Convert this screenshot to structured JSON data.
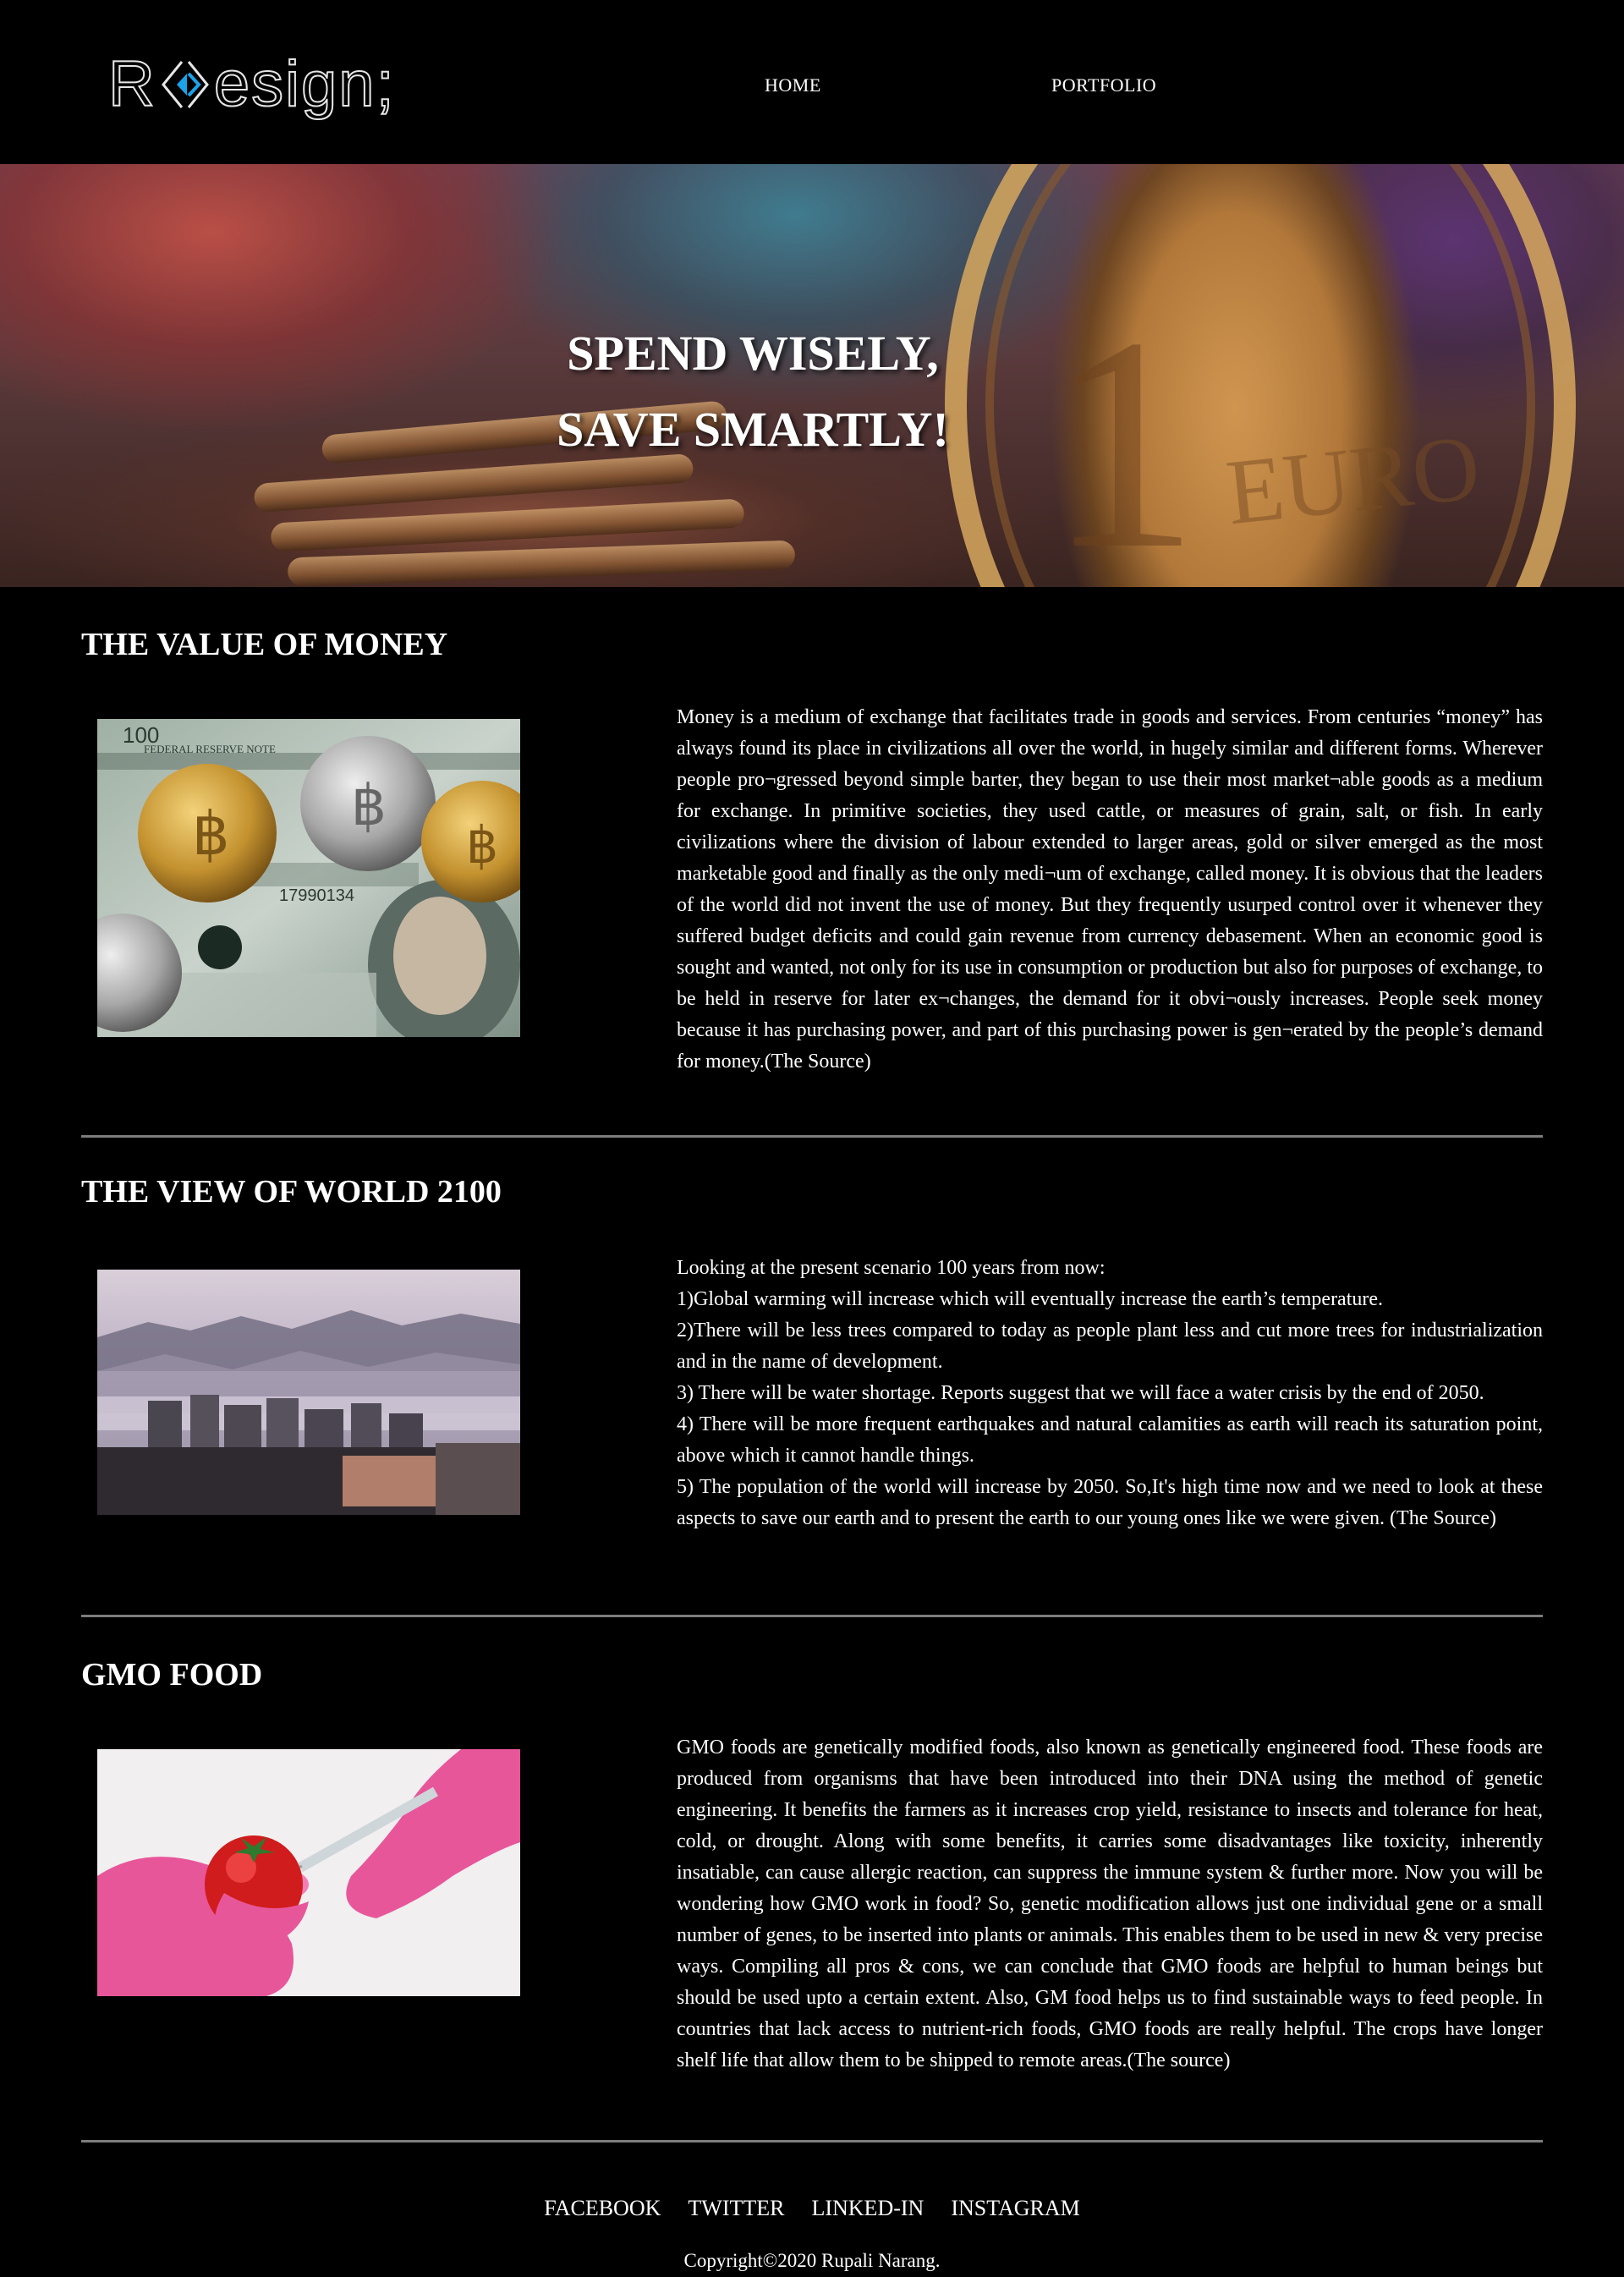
{
  "header": {
    "logo_text_start": "R",
    "logo_text_end": "esign;",
    "nav": [
      {
        "label": "HOME"
      },
      {
        "label": "PORTFOLIO"
      }
    ]
  },
  "hero": {
    "line1": "SPEND WISELY,",
    "line2": "SAVE SMARTLY!",
    "coin_numeral": "1",
    "coin_text": "EURO"
  },
  "sections": [
    {
      "title": "THE VALUE OF MONEY",
      "body": "Money is a medium of exchange that facilitates trade in goods and services. From centuries “money” has always found its place in civilizations all over the world, in hugely similar and different forms. Wherever people pro¬gressed beyond simple barter, they began to use their most market¬able goods as a medium for exchange. In primitive societies, they used cattle, or measures of grain, salt, or fish. In early civilizations where the division of labour extended to larger areas, gold or silver emerged as the most marketable good and finally as the only medi¬um of exchange, called money. It is obvious that the leaders of the world did not invent the use of money. But they frequently usurped control over it whenever they suffered budget deficits and could gain revenue from currency debasement. When an economic good is sought and wanted, not only for its use in consumption or production but also for purposes of exchange, to be held in reserve for later ex¬changes, the demand for it obvi¬ously increases. People seek money because it has purchasing power, and part of this purchasing power is gen¬erated by the people’s demand for money.(The Source)",
      "image_text": {
        "bill_label": "FEDERAL RESERVE NOTE",
        "serial": "17990134",
        "denomination": "100"
      }
    },
    {
      "title": "THE VIEW OF WORLD 2100",
      "lines": [
        "Looking at the present scenario 100 years from now:",
        "1)Global warming will increase which will eventually increase the earth’s temperature.",
        "2)There will be less trees compared to today as people plant less and cut more trees for industrialization and in the name of development.",
        "3) There will be water shortage. Reports suggest that we will face a water crisis by the end of 2050.",
        "4) There will be more frequent earthquakes and natural calamities as earth will reach its saturation point, above which it cannot handle things.",
        "5) The population of the world will increase by 2050. So,It's high time now and we need to look at these aspects to save our earth and to present the earth to our young ones like we were given. (The Source)"
      ]
    },
    {
      "title": "GMO FOOD",
      "body": "GMO foods are genetically modified foods, also known as genetically engineered food. These foods are produced from organisms that have been introduced into their DNA using the method of genetic engineering. It benefits the farmers as it increases crop yield, resistance to insects and tolerance for heat, cold, or drought. Along with some benefits, it carries some disadvantages like toxicity, inherently insatiable, can cause allergic reaction, can suppress the immune system & further more. Now you will be wondering how GMO work in food? So, genetic modification allows just one individual gene or a small number of genes, to be inserted into plants or animals. This enables them to be used in new & very precise ways. Compiling all pros & cons, we can conclude that GMO foods are helpful to human beings but should be used upto a certain extent. Also, GM food helps us to find sustainable ways to feed people. In countries that lack access to nutrient-rich foods, GMO foods are really helpful. The crops have longer shelf life that allow them to be shipped to remote areas.(The source)"
    }
  ],
  "footer": {
    "links": [
      {
        "label": "FACEBOOK"
      },
      {
        "label": "TWITTER"
      },
      {
        "label": "LINKED-IN"
      },
      {
        "label": "INSTAGRAM"
      }
    ],
    "copyright": "Copyright©2020 Rupali Narang."
  },
  "colors": {
    "background": "#000000",
    "text": "#ffffff",
    "divider": "#7c7c7c",
    "logo_accent": "#1aa3e8"
  },
  "icons": [
    "logo-chevron-icon"
  ]
}
